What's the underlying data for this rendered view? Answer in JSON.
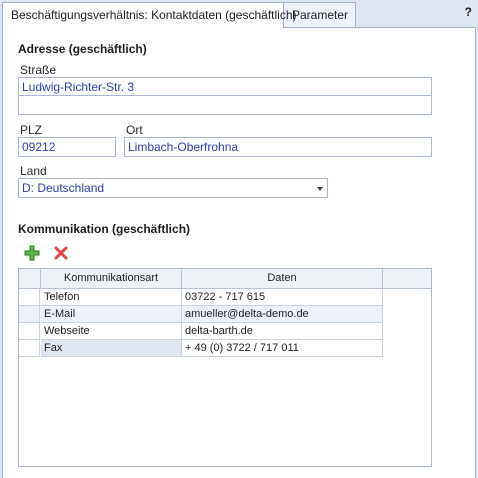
{
  "tabs": [
    {
      "label": "Beschäftigungsverhältnis: Kontaktdaten (geschäftlich)",
      "active": true
    },
    {
      "label": "Parameter",
      "active": false
    }
  ],
  "help_label": "?",
  "address": {
    "title": "Adresse (geschäftlich)",
    "street_label": "Straße",
    "street_value": "Ludwig-Richter-Str. 3",
    "street2_value": "",
    "plz_label": "PLZ",
    "plz_value": "09212",
    "ort_label": "Ort",
    "ort_value": "Limbach-Oberfrohna",
    "land_label": "Land",
    "land_value": "D: Deutschland"
  },
  "communication": {
    "title": "Kommunikation (geschäftlich)",
    "add_icon": "plus-icon",
    "delete_icon": "delete-x-icon",
    "columns": [
      "Kommunikationsart",
      "Daten"
    ],
    "rows": [
      {
        "type": "Telefon",
        "value": "03722 - 717 615"
      },
      {
        "type": "E-Mail",
        "value": "amueller@delta-demo.de"
      },
      {
        "type": "Webseite",
        "value": "delta-barth.de"
      },
      {
        "type": "Fax",
        "value": "+ 49 (0) 3722 / 717 011"
      }
    ]
  },
  "colors": {
    "accent_text": "#2b3fae",
    "window_bg": "#dde6f1",
    "border": "#9fb2c8",
    "add_green": "#4fae3e",
    "delete_red": "#e04a4a"
  }
}
